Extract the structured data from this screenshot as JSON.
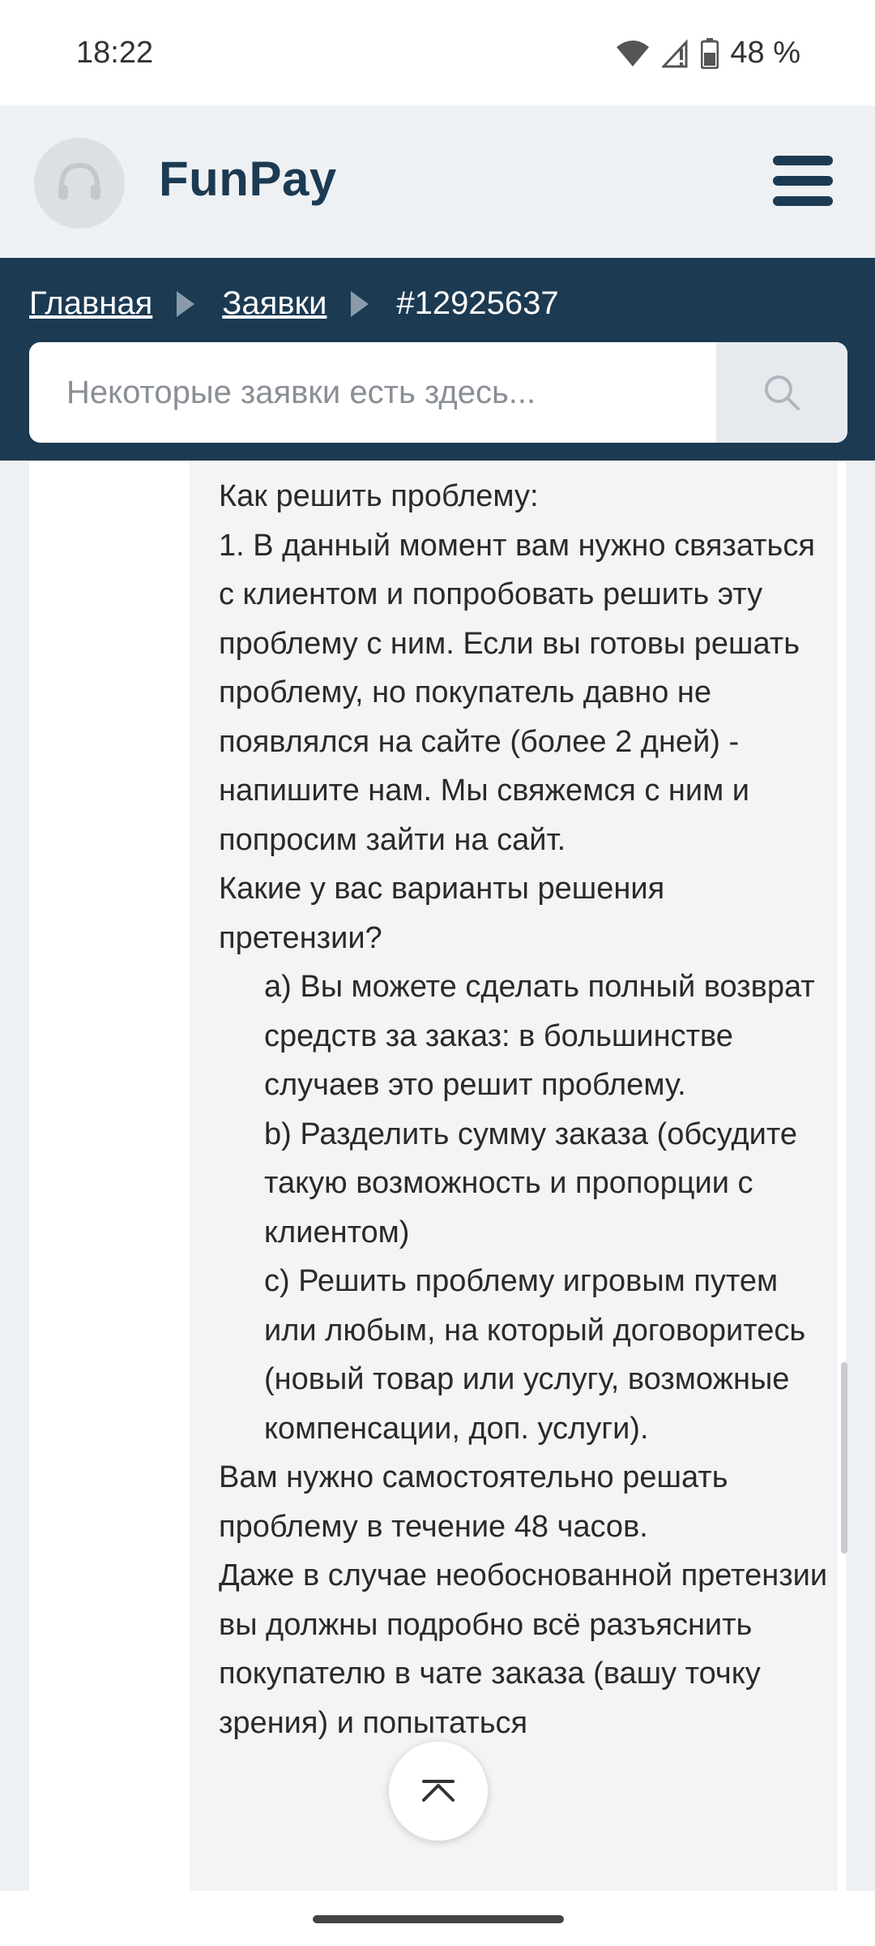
{
  "status_bar": {
    "time": "18:22",
    "battery": "48 %"
  },
  "header": {
    "brand": "FunPay",
    "logo_icon": "headset-icon",
    "menu_icon": "hamburger-icon"
  },
  "breadcrumb": {
    "home": "Главная",
    "requests": "Заявки",
    "current": "#12925637"
  },
  "search": {
    "placeholder": "Некоторые заявки есть здесь...",
    "value": "",
    "icon": "search-icon"
  },
  "message": {
    "lines": [
      "Как решить проблему:",
      "1. В данный момент вам нужно связаться с клиентом и попробовать решить эту проблему с ним. Если вы готовы решать проблему, но покупатель давно не появлялся на сайте (более 2 дней) - напишите нам. Мы свяжемся с ним и попросим зайти на сайт.",
      "Какие у вас варианты решения претензии?",
      "a) Вы можете сделать полный возврат средств за заказ: в большинстве случаев это решит проблему.",
      "b) Разделить сумму заказа (обсудите такую возможность и пропорции с клиентом)",
      "c) Решить проблему игровым путем или любым, на который договоритесь (новый товар или услугу, возможные компенсации, доп. услуги).",
      "Вам нужно самостоятельно решать проблему в течение 48 часов.",
      "Даже в случае необоснованной претензии вы должны подробно всё разъяснить покупателю в чате заказа (вашу точку зрения) и попытаться"
    ]
  },
  "scroll_top_icon": "chevron-up-icon",
  "colors": {
    "navy": "#1c3a52",
    "header_bg": "#eef1f4",
    "message_bg": "#f3f4f6"
  }
}
